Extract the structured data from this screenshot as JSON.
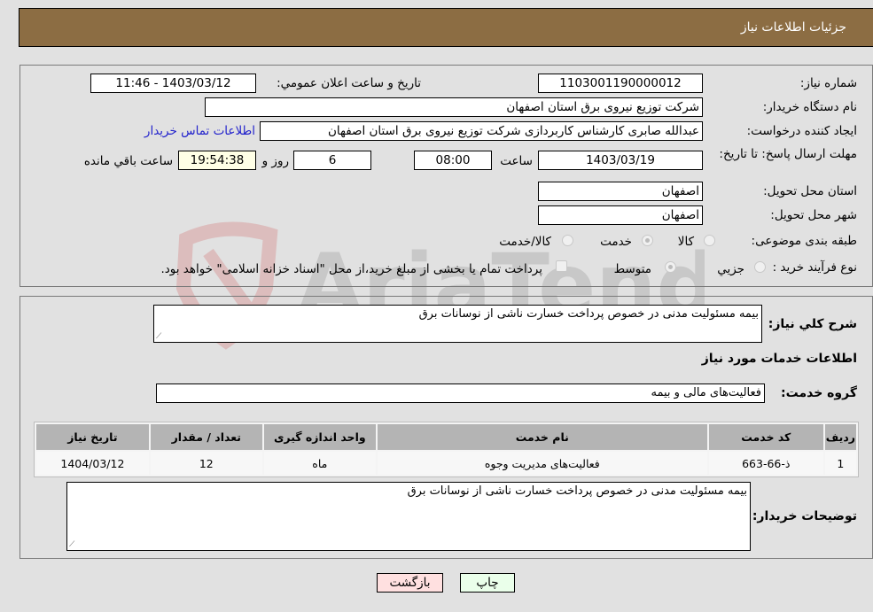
{
  "header": {
    "title": "جزئیات اطلاعات نیاز"
  },
  "fields": {
    "need_number": {
      "label": "شماره نیاز:",
      "value": "1103001190000012"
    },
    "announce_datetime": {
      "label": "تاریخ و ساعت اعلان عمومي:",
      "value": "1403/03/12 - 11:46"
    },
    "buyer_org": {
      "label": "نام دستگاه خریدار:",
      "value": "شرکت توزیع نیروی برق استان اصفهان"
    },
    "requester": {
      "label": "ایجاد کننده درخواست:",
      "value": "عبدالله صابری کارشناس کاربردازی شرکت توزیع نیروی برق استان اصفهان"
    },
    "contact_link": "اطلاعات تماس خریدار",
    "deadline": {
      "label": "مهلت ارسال پاسخ: تا تاریخ:",
      "date": "1403/03/19",
      "time_label": "ساعت",
      "time": "08:00",
      "days": "6",
      "days_label": "روز و",
      "remaining": "19:54:38",
      "remaining_label": "ساعت باقي مانده"
    },
    "delivery_province": {
      "label": "استان محل تحویل:",
      "value": "اصفهان"
    },
    "delivery_city": {
      "label": "شهر محل تحویل:",
      "value": "اصفهان"
    },
    "category": {
      "label": "طبقه بندی موضوعی:",
      "options": [
        "کالا",
        "خدمت",
        "کالا/خدمت"
      ],
      "selected": "خدمت"
    },
    "purchase_type": {
      "label": "نوع فرآیند خرید :",
      "options": [
        "جزيي",
        "متوسط"
      ],
      "selected": "متوسط",
      "treasury_note": "پرداخت تمام یا بخشی از مبلغ خرید،از محل \"اسناد خزانه اسلامی\" خواهد بود.",
      "treasury_checked": false
    }
  },
  "summary": {
    "label": "شرح كلي نياز:",
    "value": "بیمه مسئولیت مدنی در خصوص پرداخت خسارت ناشی از نوسانات برق"
  },
  "services_section": {
    "title": "اطلاعات خدمات مورد نیاز"
  },
  "service_group": {
    "label": "گروه خدمت:",
    "value": "فعالیت‌های مالی و بیمه"
  },
  "table": {
    "headers": [
      "ردیف",
      "کد خدمت",
      "نام خدمت",
      "واحد اندازه گیری",
      "تعداد / مقدار",
      "تاریخ نیاز"
    ],
    "rows": [
      [
        "1",
        "ذ-66-663",
        "فعالیت‌های مدیریت وجوه",
        "ماه",
        "12",
        "1404/03/12"
      ]
    ]
  },
  "buyer_notes": {
    "label": "توضیحات خریدار:",
    "value": "بیمه مسئولیت مدنی در خصوص پرداخت خسارت ناشی از نوسانات برق"
  },
  "buttons": {
    "print": "چاپ",
    "back": "بازگشت"
  },
  "colors": {
    "header": "#8c6d43",
    "print_bg": "#eaffea",
    "back_bg": "#ffe0e0"
  }
}
